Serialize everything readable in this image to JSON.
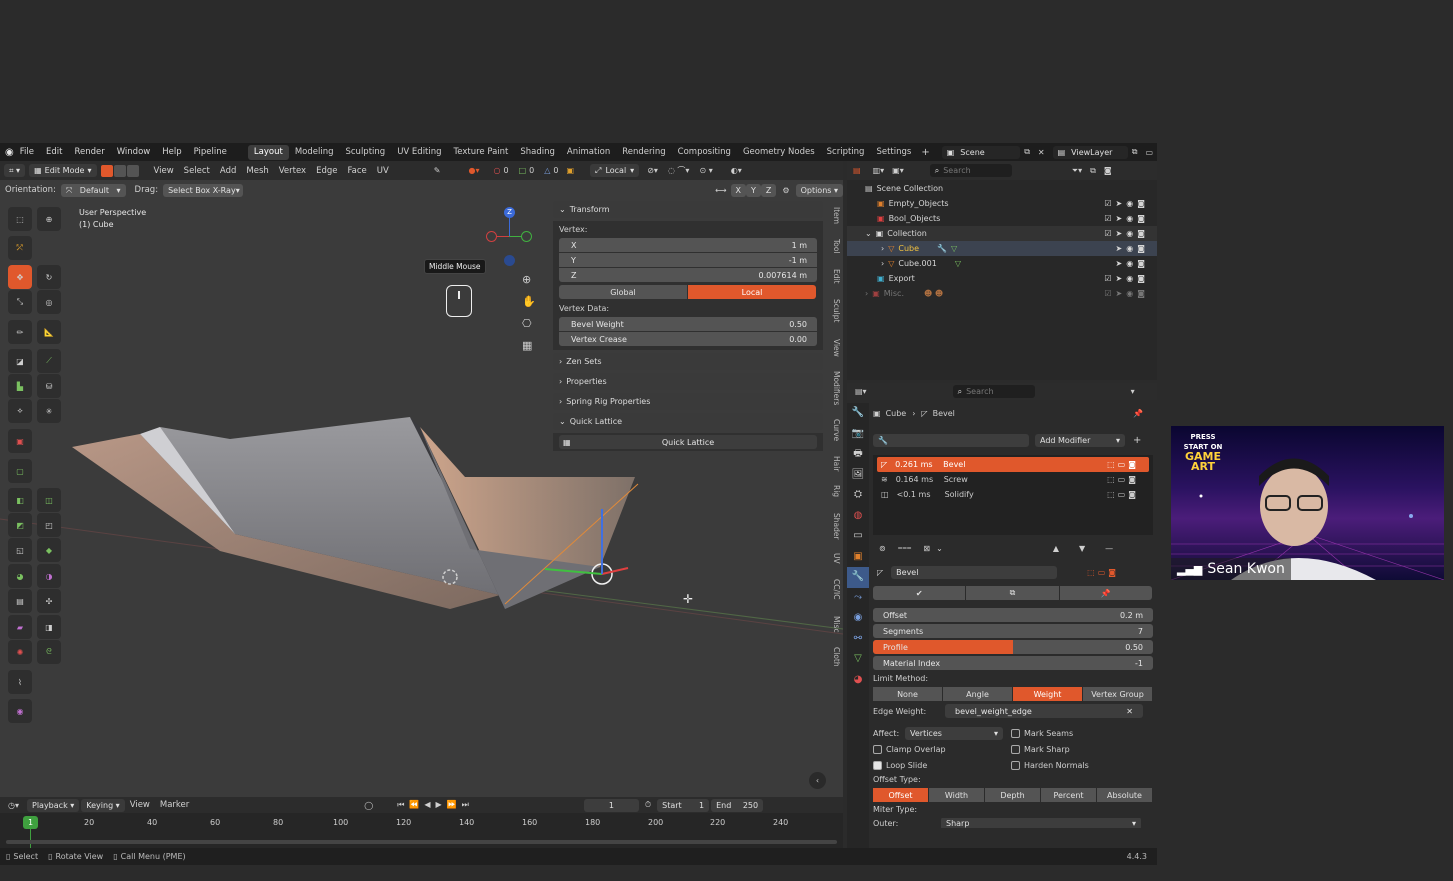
{
  "menu": [
    "File",
    "Edit",
    "Render",
    "Window",
    "Help",
    "Pipeline"
  ],
  "workspaces": [
    "Layout",
    "Modeling",
    "Sculpting",
    "UV Editing",
    "Texture Paint",
    "Shading",
    "Animation",
    "Rendering",
    "Compositing",
    "Geometry Nodes",
    "Scripting",
    "Settings"
  ],
  "active_workspace": "Layout",
  "scene": "Scene",
  "view_layer": "ViewLayer",
  "viewport": {
    "mode": "Edit Mode",
    "menus": [
      "View",
      "Select",
      "Add",
      "Mesh",
      "Vertex",
      "Edge",
      "Face",
      "UV"
    ],
    "orientation_label": "Orientation:",
    "orientation": "Default",
    "drag_label": "Drag:",
    "drag": "Select Box X-Ray",
    "pivot": "Local",
    "counts": [
      "0",
      "0",
      "0"
    ],
    "axes": [
      "X",
      "Y",
      "Z"
    ],
    "options": "Options",
    "title_line1": "User Perspective",
    "title_line2": "(1) Cube",
    "tooltip": "Middle Mouse",
    "gizmo_z": "Z"
  },
  "npanel": {
    "transform": "Transform",
    "vertex_label": "Vertex:",
    "x_label": "X",
    "x": "1 m",
    "y_label": "Y",
    "y": "-1 m",
    "z_label": "Z",
    "z": "0.007614 m",
    "global": "Global",
    "local": "Local",
    "vertex_data": "Vertex Data:",
    "bevel_weight_label": "Bevel Weight",
    "bevel_weight": "0.50",
    "vertex_crease_label": "Vertex Crease",
    "vertex_crease": "0.00",
    "zen_sets": "Zen Sets",
    "properties": "Properties",
    "spring_rig": "Spring Rig Properties",
    "quick_lattice": "Quick Lattice",
    "quick_lattice_btn": "Quick Lattice",
    "tabs": [
      "Item",
      "Tool",
      "Edit",
      "Sculpt",
      "View",
      "Modifiers",
      "Curve",
      "Hair",
      "Rig",
      "Shader",
      "UV",
      "CC/IC",
      "Misc",
      "Cloth"
    ]
  },
  "outliner": {
    "search": "Search",
    "rows": [
      {
        "label": "Scene Collection"
      },
      {
        "label": "Empty_Objects"
      },
      {
        "label": "Bool_Objects"
      },
      {
        "label": "Collection"
      },
      {
        "label": "Cube"
      },
      {
        "label": "Cube.001"
      },
      {
        "label": "Export"
      },
      {
        "label": "Misc."
      }
    ]
  },
  "properties": {
    "search": "Search",
    "breadcrumb_object": "Cube",
    "breadcrumb_modifier": "Bevel",
    "add_modifier": "Add Modifier",
    "stack": [
      {
        "time": "0.261 ms",
        "name": "Bevel"
      },
      {
        "time": "0.164 ms",
        "name": "Screw"
      },
      {
        "time": "<0.1 ms",
        "name": "Solidify"
      }
    ],
    "modifier_name": "Bevel",
    "offset_label": "Offset",
    "offset": "0.2 m",
    "segments_label": "Segments",
    "segments": "7",
    "profile_label": "Profile",
    "profile": "0.50",
    "profile_fill": 0.5,
    "material_index_label": "Material Index",
    "material_index": "-1",
    "limit_method_label": "Limit Method:",
    "limit_methods": [
      "None",
      "Angle",
      "Weight",
      "Vertex Group"
    ],
    "limit_active": "Weight",
    "edge_weight_label": "Edge Weight:",
    "edge_weight": "bevel_weight_edge",
    "affect_label": "Affect:",
    "affect": "Vertices",
    "mark_seams": "Mark Seams",
    "clamp_overlap": "Clamp Overlap",
    "mark_sharp": "Mark Sharp",
    "loop_slide": "Loop Slide",
    "harden_normals": "Harden Normals",
    "offset_type_label": "Offset Type:",
    "offset_types": [
      "Offset",
      "Width",
      "Depth",
      "Percent",
      "Absolute"
    ],
    "offset_type_active": "Offset",
    "miter_type_label": "Miter Type:",
    "outer_label": "Outer:",
    "outer": "Sharp"
  },
  "timeline": {
    "playback": "Playback",
    "keying": "Keying",
    "view": "View",
    "marker": "Marker",
    "current_frame": "1",
    "start_label": "Start",
    "start": "1",
    "end_label": "End",
    "end": "250",
    "ticks": [
      "1",
      "20",
      "40",
      "60",
      "80",
      "100",
      "120",
      "140",
      "160",
      "180",
      "200",
      "220",
      "240"
    ]
  },
  "status": {
    "select": "Select",
    "rotate": "Rotate View",
    "call_menu": "Call Menu (PME)",
    "version": "4.4.3"
  },
  "webcam": {
    "name": "Sean Kwon",
    "banner_line1": "PRESS",
    "banner_line2": "START ON",
    "banner_line3": "GAME ART"
  },
  "colors": {
    "accent": "#e0582c",
    "header": "#1d1d1d",
    "panel": "#303030"
  }
}
